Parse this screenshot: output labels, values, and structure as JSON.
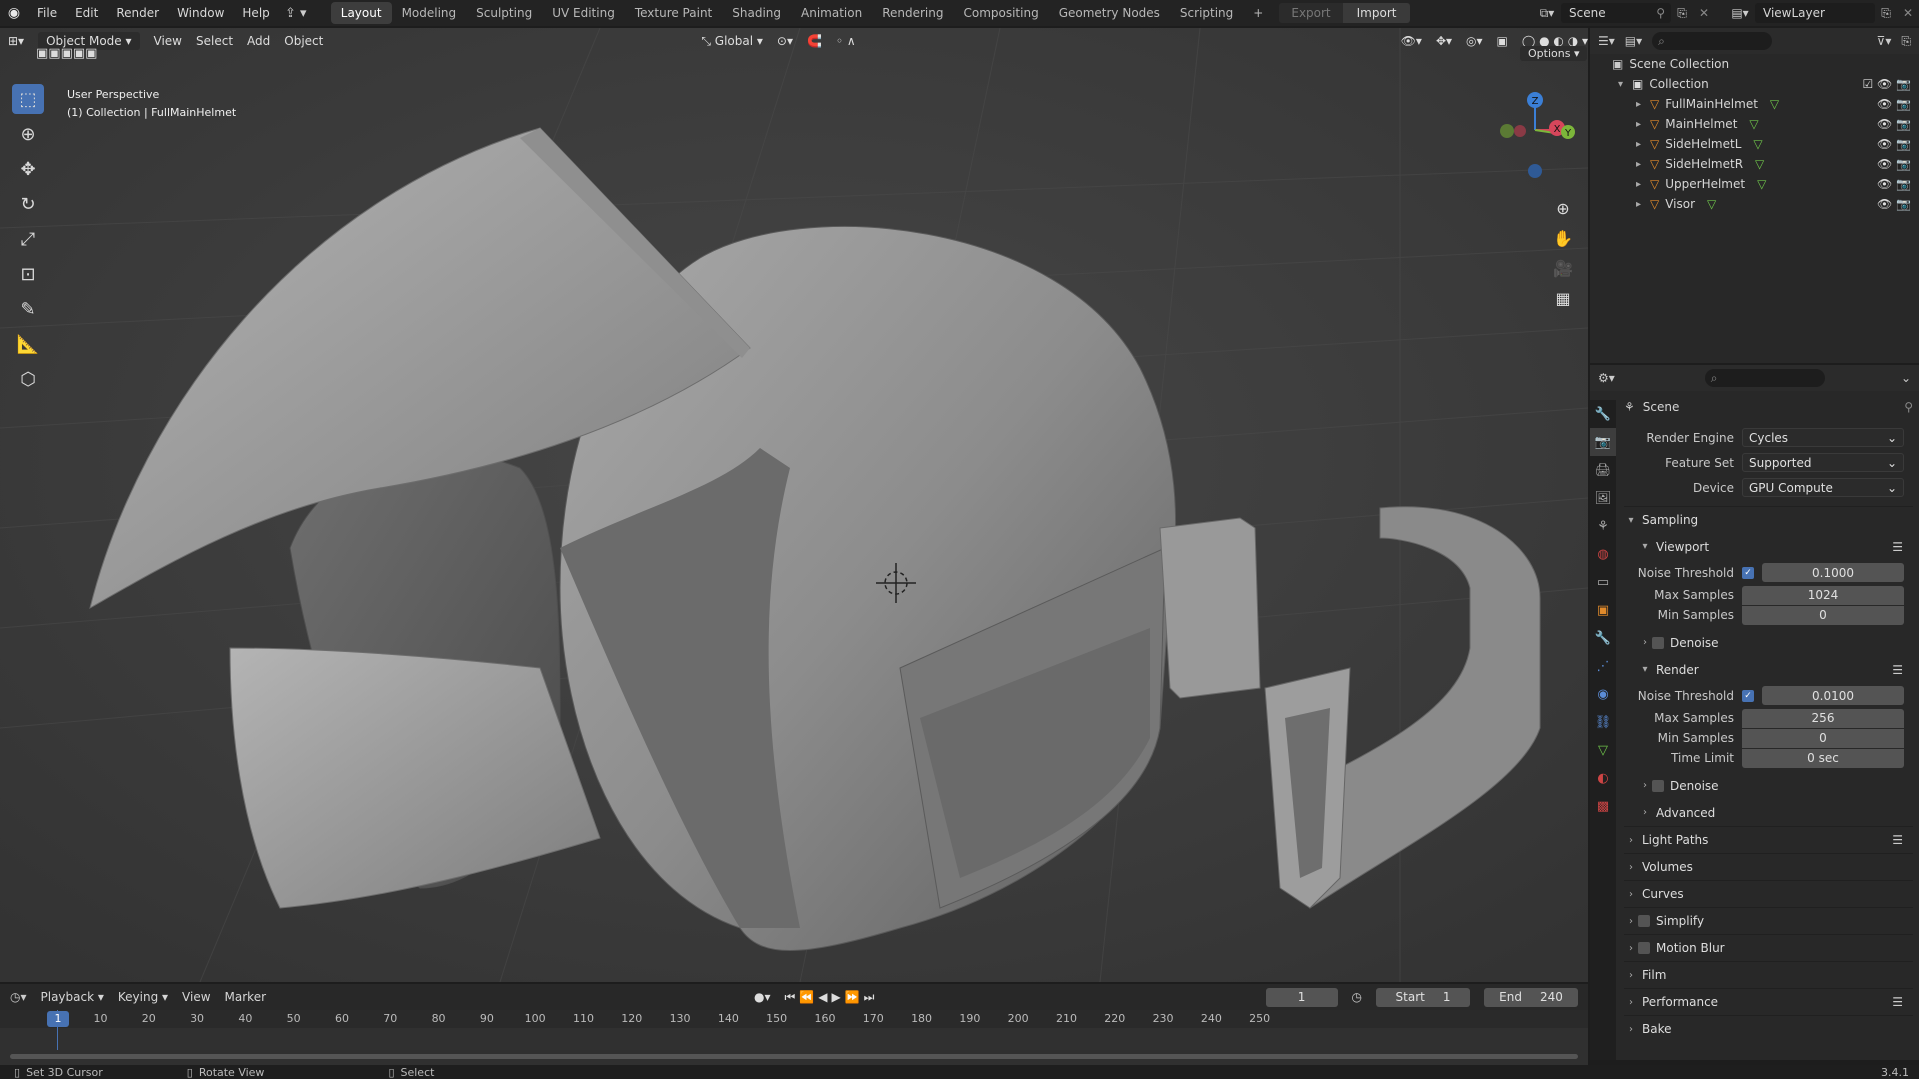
{
  "app": {
    "version": "3.4.1"
  },
  "topbar": {
    "menus": [
      "File",
      "Edit",
      "Render",
      "Window",
      "Help"
    ],
    "workspaces": [
      "Layout",
      "Modeling",
      "Sculpting",
      "UV Editing",
      "Texture Paint",
      "Shading",
      "Animation",
      "Rendering",
      "Compositing",
      "Geometry Nodes",
      "Scripting"
    ],
    "active_workspace": "Layout",
    "add_tab": "+",
    "export_label": "Export",
    "import_label": "Import",
    "scene_name": "Scene",
    "view_layer": "ViewLayer"
  },
  "viewport": {
    "mode": "Object Mode",
    "menus": [
      "View",
      "Select",
      "Add",
      "Object"
    ],
    "transform_orientation": "Global",
    "options_label": "Options",
    "overlay_title": "User Perspective",
    "overlay_subtitle": "(1) Collection | FullMainHelmet",
    "gizmo": {
      "x": "X",
      "y": "Y",
      "z": "Z"
    }
  },
  "outliner": {
    "root": "Scene Collection",
    "collection": "Collection",
    "objects": [
      "FullMainHelmet",
      "MainHelmet",
      "SideHelmetL",
      "SideHelmetR",
      "UpperHelmet",
      "Visor"
    ]
  },
  "properties": {
    "context": "Scene",
    "render_engine": {
      "label": "Render Engine",
      "value": "Cycles"
    },
    "feature_set": {
      "label": "Feature Set",
      "value": "Supported"
    },
    "device": {
      "label": "Device",
      "value": "GPU Compute"
    },
    "sampling": {
      "title": "Sampling",
      "viewport": {
        "title": "Viewport",
        "noise_threshold_label": "Noise Threshold",
        "noise_threshold": "0.1000",
        "max_samples_label": "Max Samples",
        "max_samples": "1024",
        "min_samples_label": "Min Samples",
        "min_samples": "0",
        "denoise_label": "Denoise"
      },
      "render": {
        "title": "Render",
        "noise_threshold_label": "Noise Threshold",
        "noise_threshold": "0.0100",
        "max_samples_label": "Max Samples",
        "max_samples": "256",
        "min_samples_label": "Min Samples",
        "min_samples": "0",
        "time_limit_label": "Time Limit",
        "time_limit": "0 sec",
        "denoise_label": "Denoise"
      },
      "advanced": "Advanced"
    },
    "panels": [
      "Light Paths",
      "Volumes",
      "Curves",
      "Simplify",
      "Motion Blur",
      "Film",
      "Performance",
      "Bake"
    ]
  },
  "timeline": {
    "menus": [
      "Playback",
      "Keying",
      "View",
      "Marker"
    ],
    "current_frame": "1",
    "start_label": "Start",
    "start": "1",
    "end_label": "End",
    "end": "240",
    "ticks": [
      "1",
      "10",
      "20",
      "30",
      "40",
      "50",
      "60",
      "70",
      "80",
      "90",
      "100",
      "110",
      "120",
      "130",
      "140",
      "150",
      "160",
      "170",
      "180",
      "190",
      "200",
      "210",
      "220",
      "230",
      "240",
      "250"
    ]
  },
  "statusbar": {
    "items": [
      "Set 3D Cursor",
      "Rotate View",
      "Select"
    ]
  },
  "colors": {
    "accent": "#4772b3",
    "viewport_bg": "#3d3d3d",
    "panel_bg": "#282828"
  }
}
